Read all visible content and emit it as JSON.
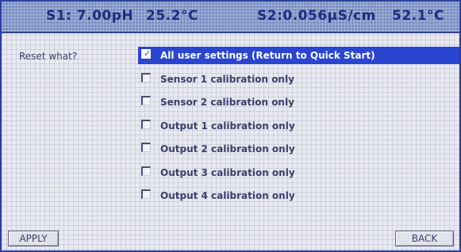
{
  "header": {
    "s1_label": "S1: 7.00pH",
    "s1_temp": "25.2°C",
    "s2_label": "S2:0.056μS/cm",
    "s2_temp": "52.1°C"
  },
  "prompt": "Reset what?",
  "options": [
    {
      "label": "All user settings (Return to Quick Start)",
      "checked": true,
      "selected": true
    },
    {
      "label": "Sensor 1 calibration only",
      "checked": false,
      "selected": false
    },
    {
      "label": "Sensor 2 calibration only",
      "checked": false,
      "selected": false
    },
    {
      "label": "Output 1 calibration only",
      "checked": false,
      "selected": false
    },
    {
      "label": "Output 2 calibration only",
      "checked": false,
      "selected": false
    },
    {
      "label": "Output 3 calibration only",
      "checked": false,
      "selected": false
    },
    {
      "label": "Output 4 calibration only",
      "checked": false,
      "selected": false
    }
  ],
  "buttons": {
    "apply": "APPLY",
    "back": "BACK"
  },
  "colors": {
    "header_bg": "#7a8fc3",
    "header_text": "#1c2d7d",
    "selection": "#2a45cf",
    "screen_bg": "#e9eaf1",
    "text": "#3b3f6a"
  }
}
